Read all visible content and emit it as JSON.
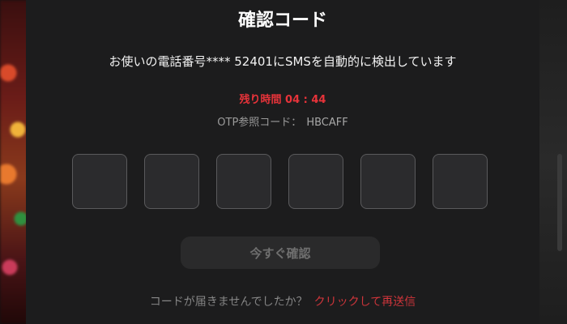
{
  "modal": {
    "title": "確認コード",
    "subtitle": "お使いの電話番号**** 52401にSMSを自動的に検出しています",
    "timer_label": "残り時間 04 : 44",
    "otp_ref_label": "OTP参照コード：",
    "otp_ref_code": "HBCAFF",
    "otp_boxes": [
      "",
      "",
      "",
      "",
      "",
      ""
    ],
    "submit_label": "今すぐ確認",
    "resend_question": "コードが届きませんでしたか？",
    "resend_link": "クリックして再送信"
  },
  "colors": {
    "background": "#1c1c1d",
    "accent_red": "#e8333a",
    "box_border": "#5a5a5c"
  }
}
